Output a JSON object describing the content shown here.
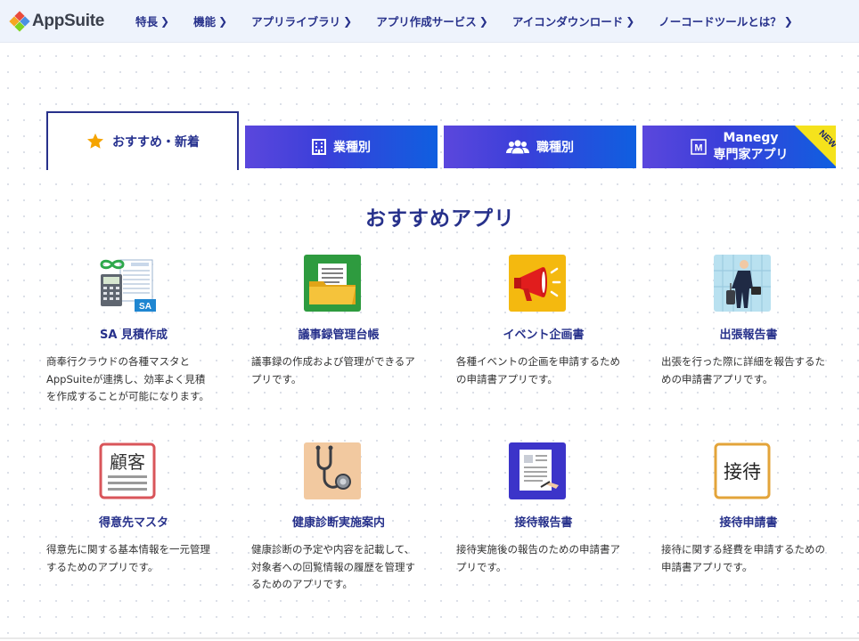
{
  "header": {
    "logo_text": "AppSuite",
    "nav": [
      {
        "label": "特長",
        "chevron": "chevron-right-icon"
      },
      {
        "label": "機能",
        "chevron": "chevron-right-icon"
      },
      {
        "label": "アプリライブラリ",
        "chevron": "chevron-right-icon"
      },
      {
        "label": "アプリ作成サービス",
        "chevron": "chevron-right-icon"
      },
      {
        "label": "アイコンダウンロード",
        "chevron": "chevron-right-icon"
      },
      {
        "label": "ノーコードツールとは？",
        "chevron": "chevron-right-icon"
      }
    ]
  },
  "tabs": [
    {
      "label": "おすすめ・新着",
      "icon": "star-icon",
      "active": true
    },
    {
      "label": "業種別",
      "icon": "building-icon",
      "active": false
    },
    {
      "label": "職種別",
      "icon": "people-icon",
      "active": false
    },
    {
      "label_line1": "Manegy",
      "label_line2": "専門家アプリ",
      "icon": "m-square-icon",
      "badge": "NEW",
      "active": false
    }
  ],
  "colors": {
    "accent": "#27318b",
    "tab_gradient_start": "#5b47dd",
    "tab_gradient_end": "#0f5fe0",
    "badge": "#f5e21c",
    "star": "#f5a400"
  },
  "section_title": "おすすめアプリ",
  "apps": [
    {
      "title": "SA 見積作成",
      "icon": "estimate-sa-icon",
      "desc": "商奉行クラウドの各種マスタとAppSuiteが連携し、効率よく見積を作成することが可能になります。"
    },
    {
      "title": "議事録管理台帳",
      "icon": "folder-document-icon",
      "desc": "議事録の作成および管理ができるアプリです。"
    },
    {
      "title": "イベント企画書",
      "icon": "megaphone-icon",
      "desc": "各種イベントの企画を申請するための申請書アプリです。"
    },
    {
      "title": "出張報告書",
      "icon": "business-traveler-icon",
      "desc": "出張を行った際に詳細を報告するための申請書アプリです。"
    },
    {
      "title": "得意先マスタ",
      "icon": "customer-card-icon",
      "icon_text": "顧客",
      "desc": "得意先に関する基本情報を一元管理するためのアプリです。"
    },
    {
      "title": "健康診断実施案内",
      "icon": "stethoscope-icon",
      "desc": "健康診断の予定や内容を記載して、対象者への回覧情報の履歴を管理するためのアプリです。"
    },
    {
      "title": "接待報告書",
      "icon": "report-document-icon",
      "desc": "接待実施後の報告のための申請書アプリです。"
    },
    {
      "title": "接待申請書",
      "icon": "entertainment-card-icon",
      "icon_text": "接待",
      "desc": "接待に関する経費を申請するための申請書アプリです。"
    }
  ]
}
